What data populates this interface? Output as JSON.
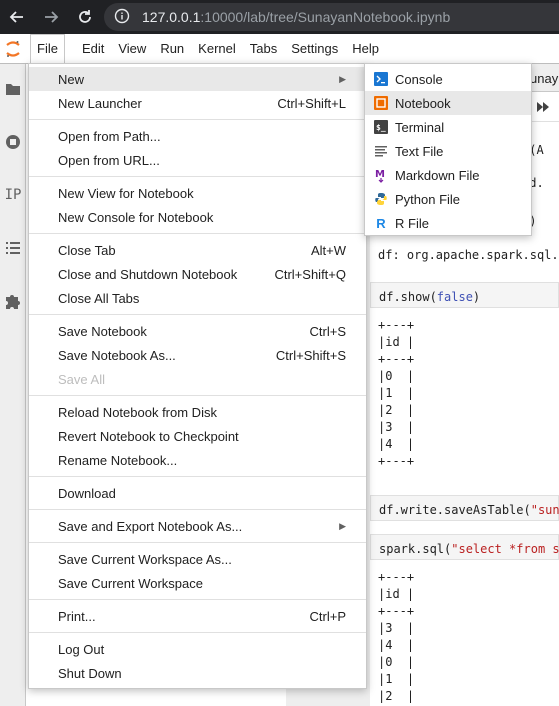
{
  "browser": {
    "url_host": "127.0.0.1",
    "url_path": ":10000/lab/tree/SunayanNotebook.ipynb"
  },
  "menubar": {
    "items": [
      "File",
      "Edit",
      "View",
      "Run",
      "Kernel",
      "Tabs",
      "Settings",
      "Help"
    ]
  },
  "sidebar": {
    "icons": [
      "folder-icon",
      "running-icon",
      "ip-icon",
      "list-icon",
      "extension-icon"
    ],
    "ip_label": "IP"
  },
  "notebook": {
    "tab_fragment": "unay",
    "lines": {
      "l1": "e(A",
      "l2": "dd.",
      "l3": "s)",
      "l4": "df: org.apache.spark.sql.",
      "cell1_a": "df.show(",
      "cell1_b": "false",
      "cell1_c": ")",
      "out1": "+---+\n|id |\n+---+\n|0  |\n|1  |\n|2  |\n|3  |\n|4  |\n+---+",
      "cell2_a": "df.write.saveAsTable(",
      "cell2_b": "\"suna",
      "cell3_a": "spark.sql(",
      "cell3_b": "\"select *from su",
      "out2": "+---+\n|id |\n+---+\n|3  |\n|4  |\n|0  |\n|1  |\n|2  |"
    }
  },
  "file_menu": {
    "new": "New",
    "new_launcher": "New Launcher",
    "new_launcher_sc": "Ctrl+Shift+L",
    "open_path": "Open from Path...",
    "open_url": "Open from URL...",
    "new_view": "New View for Notebook",
    "new_console": "New Console for Notebook",
    "close_tab": "Close Tab",
    "close_tab_sc": "Alt+W",
    "close_shutdown": "Close and Shutdown Notebook",
    "close_shutdown_sc": "Ctrl+Shift+Q",
    "close_all": "Close All Tabs",
    "save": "Save Notebook",
    "save_sc": "Ctrl+S",
    "save_as": "Save Notebook As...",
    "save_as_sc": "Ctrl+Shift+S",
    "save_all": "Save All",
    "reload": "Reload Notebook from Disk",
    "revert": "Revert Notebook to Checkpoint",
    "rename": "Rename Notebook...",
    "download": "Download",
    "save_export": "Save and Export Notebook As...",
    "save_workspace_as": "Save Current Workspace As...",
    "save_workspace": "Save Current Workspace",
    "print": "Print...",
    "print_sc": "Ctrl+P",
    "logout": "Log Out",
    "shutdown": "Shut Down"
  },
  "new_submenu": {
    "console": "Console",
    "notebook": "Notebook",
    "terminal": "Terminal",
    "text_file": "Text File",
    "markdown_file": "Markdown File",
    "python_file": "Python File",
    "r_file": "R File"
  },
  "colors": {
    "accent": "#1976d2",
    "jupyter_orange": "#f37626",
    "menu_hover": "#e8e8e8"
  }
}
